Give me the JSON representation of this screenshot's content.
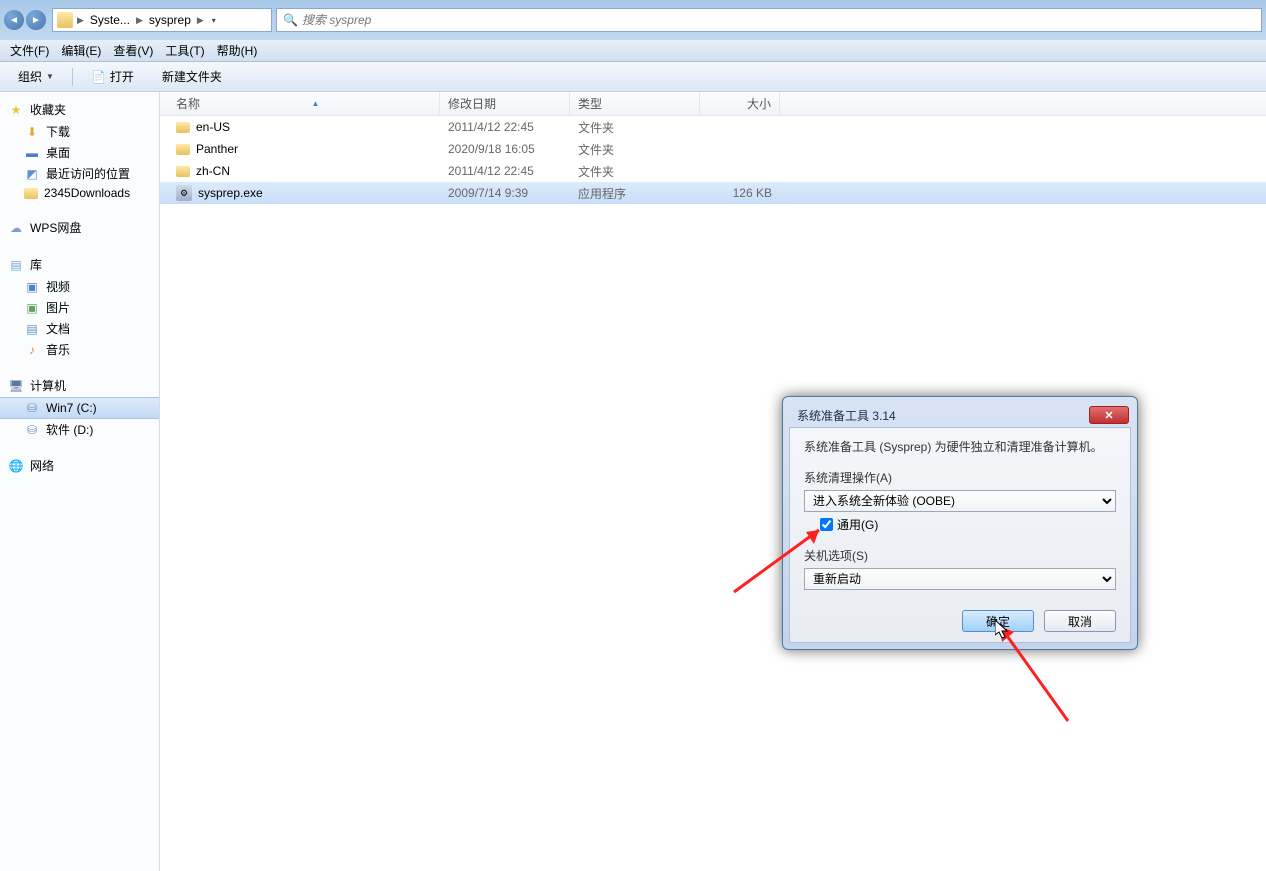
{
  "breadcrumb": {
    "part1": "Syste...",
    "part2": "sysprep"
  },
  "search": {
    "placeholder": "搜索 sysprep"
  },
  "menu": {
    "file": "文件(F)",
    "edit": "编辑(E)",
    "view": "查看(V)",
    "tools": "工具(T)",
    "help": "帮助(H)"
  },
  "toolbar": {
    "organize": "组织",
    "open": "打开",
    "newfolder": "新建文件夹"
  },
  "sidebar": {
    "favorites": {
      "header": "收藏夹",
      "items": [
        "下载",
        "桌面",
        "最近访问的位置",
        "2345Downloads"
      ]
    },
    "wps": {
      "header": "WPS网盘"
    },
    "libraries": {
      "header": "库",
      "items": [
        "视频",
        "图片",
        "文档",
        "音乐"
      ]
    },
    "computer": {
      "header": "计算机",
      "items": [
        "Win7 (C:)",
        "软件 (D:)"
      ]
    },
    "network": {
      "header": "网络"
    }
  },
  "columns": {
    "name": "名称",
    "date": "修改日期",
    "type": "类型",
    "size": "大小"
  },
  "files": [
    {
      "name": "en-US",
      "date": "2011/4/12 22:45",
      "type": "文件夹",
      "size": "",
      "icon": "folder"
    },
    {
      "name": "Panther",
      "date": "2020/9/18 16:05",
      "type": "文件夹",
      "size": "",
      "icon": "folder"
    },
    {
      "name": "zh-CN",
      "date": "2011/4/12 22:45",
      "type": "文件夹",
      "size": "",
      "icon": "folder"
    },
    {
      "name": "sysprep.exe",
      "date": "2009/7/14 9:39",
      "type": "应用程序",
      "size": "126 KB",
      "icon": "exe",
      "selected": true
    }
  ],
  "dialog": {
    "title": "系统准备工具 3.14",
    "desc": "系统准备工具 (Sysprep) 为硬件独立和清理准备计算机。",
    "cleanup_label": "系统清理操作(A)",
    "cleanup_value": "进入系统全新体验 (OOBE)",
    "generalize": "通用(G)",
    "shutdown_label": "关机选项(S)",
    "shutdown_value": "重新启动",
    "ok": "确定",
    "cancel": "取消"
  }
}
